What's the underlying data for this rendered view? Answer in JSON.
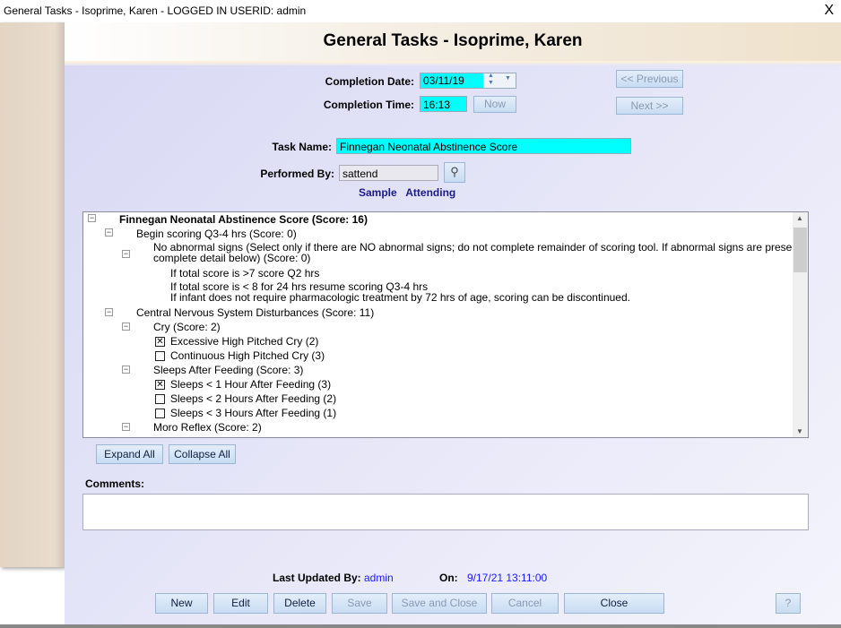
{
  "window": {
    "title": "General Tasks  -  Isoprime, Karen   -  LOGGED IN USERID: admin",
    "close": "X"
  },
  "header": {
    "title": "General Tasks - Isoprime, Karen"
  },
  "completion": {
    "date_label": "Completion Date:",
    "date": "03/11/19",
    "time_label": "Completion Time:",
    "time": "16:13",
    "now": "Now"
  },
  "nav": {
    "previous": "<< Previous",
    "next": "Next >>"
  },
  "task": {
    "name_label": "Task Name:",
    "name": "Finnegan Neonatal Abstinence Score",
    "performed_label": "Performed By:",
    "performed": "sattend",
    "performer_name": "Sample   Attending"
  },
  "tree": {
    "root": "Finnegan Neonatal Abstinence Score (Score: 16)",
    "begin": "Begin scoring Q3-4 hrs (Score: 0)",
    "noabn1": "No abnormal signs (Select only if there are NO abnormal signs; do not complete remainder of scoring tool. If abnormal signs are present",
    "noabn2": "complete detail below) (Score: 0)",
    "note1": "If total score is >7 score Q2 hrs",
    "note2": "If total score is < 8 for 24 hrs resume scoring Q3-4 hrs",
    "note3": "If infant does not require pharmacologic treatment by 72 hrs of age, scoring can be discontinued.",
    "cns": "Central Nervous System Disturbances (Score: 11)",
    "cry": "Cry (Score: 2)",
    "cry1": "Excessive High Pitched Cry (2)",
    "cry2": "Continuous High Pitched Cry (3)",
    "sleep": "Sleeps After Feeding (Score: 3)",
    "sleep1": "Sleeps < 1 Hour After Feeding (3)",
    "sleep2": "Sleeps < 2 Hours After Feeding (2)",
    "sleep3": "Sleeps < 3 Hours After Feeding (1)",
    "moro": "Moro Reflex (Score: 2)"
  },
  "checked": {
    "cry1": true,
    "cry2": false,
    "sleep1": true,
    "sleep2": false,
    "sleep3": false
  },
  "tree_buttons": {
    "expand": "Expand All",
    "collapse": "Collapse All"
  },
  "comments": {
    "label": "Comments:",
    "value": ""
  },
  "footer": {
    "updated_label": "Last Updated By:",
    "updated_by": "admin",
    "on_label": "On:",
    "on": "9/17/21 13:11:00"
  },
  "buttons": {
    "new": "New",
    "edit": "Edit",
    "delete": "Delete",
    "save": "Save",
    "save_close": "Save and Close",
    "cancel": "Cancel",
    "close": "Close",
    "help": "?"
  }
}
